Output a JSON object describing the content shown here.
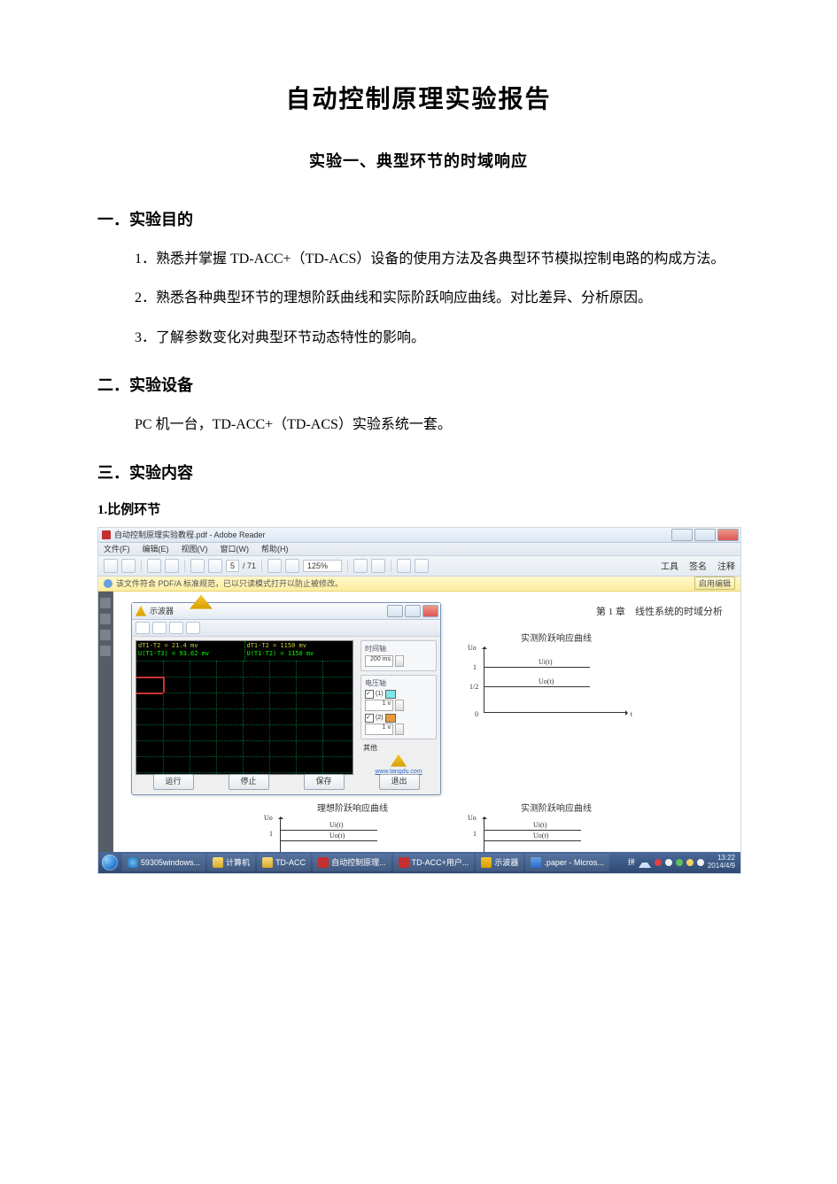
{
  "title": "自动控制原理实验报告",
  "subtitle": "实验一、典型环节的时域响应",
  "section1": {
    "heading": "一．实验目的",
    "p1": "1．熟悉并掌握 TD-ACC+（TD-ACS）设备的使用方法及各典型环节模拟控制电路的构成方法。",
    "p2": "2．熟悉各种典型环节的理想阶跃曲线和实际阶跃响应曲线。对比差异、分析原因。",
    "p3": "3．了解参数变化对典型环节动态特性的影响。"
  },
  "section2": {
    "heading": "二．实验设备",
    "p1": "PC 机一台，TD-ACC+（TD-ACS）实验系统一套。"
  },
  "section3": {
    "heading": "三．实验内容",
    "sub1": "1.比例环节"
  },
  "adobe": {
    "title_prefix": "自动控制原理实验教程.pdf - Adobe Reader",
    "menu": {
      "file": "文件(F)",
      "edit": "编辑(E)",
      "view": "视图(V)",
      "window": "窗口(W)",
      "help": "帮助(H)"
    },
    "toolbar": {
      "page": "5",
      "total": "/ 71",
      "zoom": "125%"
    },
    "right_links": {
      "tools": "工具",
      "sign": "签名",
      "comment": "注释"
    },
    "infobar": "该文件符合 PDF/A 标准规范，已以只读模式打开以防止被修改。",
    "infobar_btn": "启用编辑"
  },
  "scope": {
    "title": "示波器",
    "hdr": {
      "l1a": "dT1-T2 = 21.4 mv",
      "l1b": "dT1-T2 = 1150 mv",
      "l2a": "U(T1-T3) = 93.62 mv",
      "l2b": "U(T1-T2) = 1150 mv"
    },
    "panel": {
      "time_lbl": "时间轴",
      "time_val": "200 ms",
      "volt_lbl": "电压轴",
      "ch1_chk": "☑",
      "ch1_num": "1 v",
      "ch2_chk": "☑",
      "ch2_num": "1 v",
      "other_lbl": "其他"
    },
    "link": "www.tangdu.com",
    "btn_run": "运行",
    "btn_stop": "停止",
    "btn_save": "保存",
    "btn_exit": "退出"
  },
  "pdf_body": {
    "chapter": "第 1 章　线性系统的时域分析",
    "curve_meas": "实测阶跃响应曲线",
    "curve_ideal": "理想阶跃响应曲线",
    "uo": "Uo",
    "ui": "Ui(t)",
    "uo_t": "Uo(t)",
    "t": "t",
    "one": "1",
    "half": "1/2",
    "zero": "0"
  },
  "taskbar": {
    "ie": "59305windows...",
    "folder1": "计算机",
    "folder2": "TD-ACC",
    "pdf1": "自动控制原理...",
    "pdf2": "TD-ACC+用户...",
    "osc": "示波器",
    "word": ".paper - Micros...",
    "time": "13:22",
    "date": "2014/4/9",
    "lang": "拼"
  }
}
